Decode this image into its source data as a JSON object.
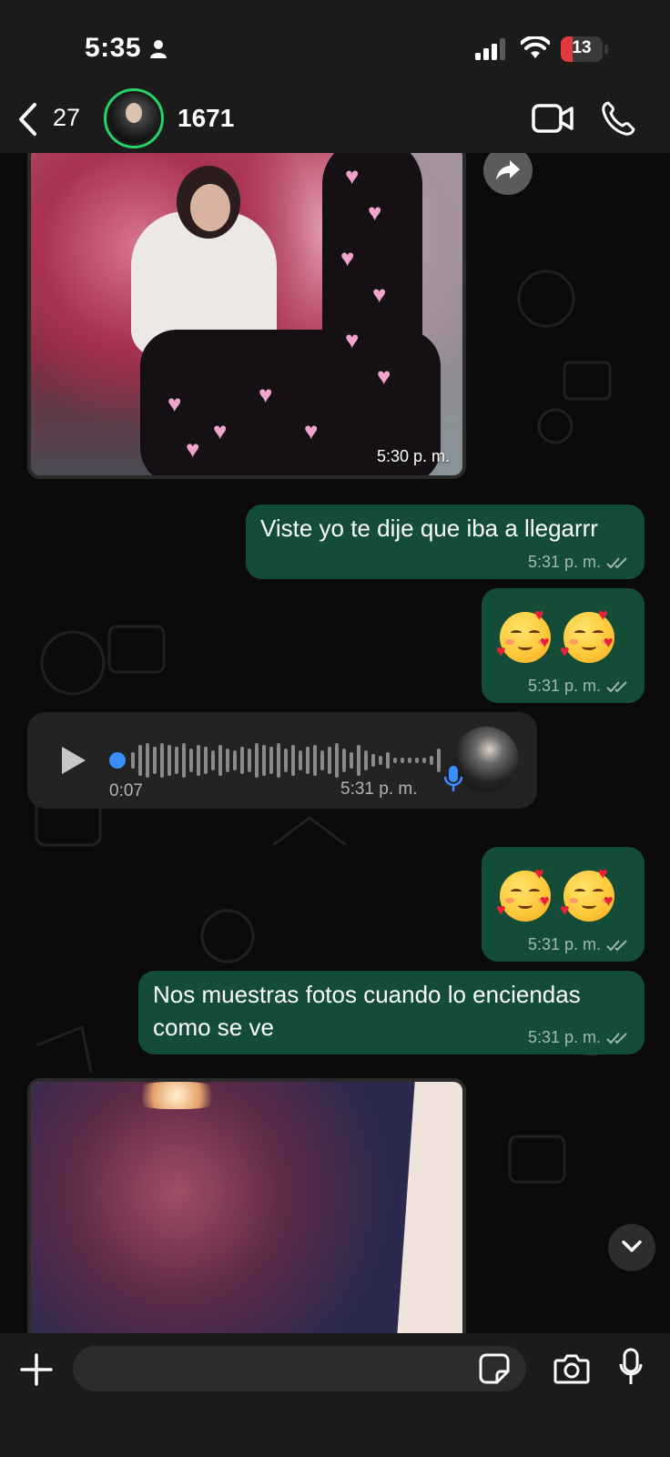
{
  "status": {
    "time": "5:35",
    "battery": "13"
  },
  "header": {
    "unread_count": "27",
    "contact_name": "1671"
  },
  "messages": [
    {
      "type": "image",
      "timestamp": "5:30 p. m."
    },
    {
      "type": "text",
      "text": "Viste yo te dije que iba a llegarrr",
      "timestamp": "5:31 p. m."
    },
    {
      "type": "emoji",
      "text": "🥰 🥰",
      "timestamp": "5:31 p. m."
    },
    {
      "type": "voice",
      "duration": "0:07",
      "timestamp": "5:31 p. m."
    },
    {
      "type": "emoji",
      "text": "🥰 🥰",
      "timestamp": "5:31 p. m."
    },
    {
      "type": "text",
      "text": "Nos muestras fotos cuando lo enciendas como se ve",
      "timestamp": "5:31 p. m."
    },
    {
      "type": "image"
    }
  ],
  "input": {
    "placeholder": ""
  },
  "colors": {
    "outgoing_bubble": "#144d37",
    "incoming_bubble": "#232323",
    "accent": "#25d366",
    "battery_low": "#e0393e"
  },
  "icons": [
    "back-chevron-icon",
    "video-call-icon",
    "phone-icon",
    "forward-icon",
    "play-icon",
    "mic-icon",
    "chevron-down-icon",
    "plus-icon",
    "sticker-icon",
    "camera-icon"
  ]
}
